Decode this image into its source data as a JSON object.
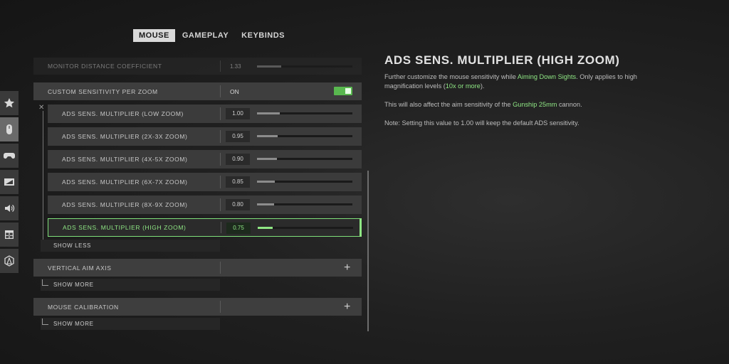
{
  "tabs": [
    "MOUSE",
    "GAMEPLAY",
    "KEYBINDS"
  ],
  "active_tab": "MOUSE",
  "sidebar_icons": [
    "star-icon",
    "mouse-icon",
    "gamepad-icon",
    "display-icon",
    "speaker-icon",
    "window-icon",
    "network-icon"
  ],
  "dim_row": {
    "label": "MONITOR DISTANCE COEFFICIENT",
    "value": "1.33",
    "level": 0.25
  },
  "custom_row": {
    "label": "CUSTOM SENSITIVITY PER ZOOM",
    "value": "ON"
  },
  "zoom_rows": [
    {
      "label": "ADS SENS. MULTIPLIER (LOW ZOOM)",
      "value": "1.00",
      "level": 0.24
    },
    {
      "label": "ADS SENS. MULTIPLIER (2X-3X ZOOM)",
      "value": "0.95",
      "level": 0.22
    },
    {
      "label": "ADS SENS. MULTIPLIER (4X-5X ZOOM)",
      "value": "0.90",
      "level": 0.21
    },
    {
      "label": "ADS SENS. MULTIPLIER (6X-7X ZOOM)",
      "value": "0.85",
      "level": 0.19
    },
    {
      "label": "ADS SENS. MULTIPLIER (8X-9X ZOOM)",
      "value": "0.80",
      "level": 0.18
    },
    {
      "label": "ADS SENS. MULTIPLIER (HIGH ZOOM)",
      "value": "0.75",
      "level": 0.16
    }
  ],
  "show_less": "SHOW LESS",
  "vertical_aim": {
    "label": "VERTICAL AIM AXIS",
    "show_more": "SHOW MORE"
  },
  "mouse_calibration": {
    "label": "MOUSE CALIBRATION",
    "show_more": "SHOW MORE"
  },
  "detail": {
    "title": "ADS SENS. MULTIPLIER (HIGH ZOOM)",
    "p1_a": "Further customize the mouse sensitivity while ",
    "p1_hl1": "Aiming Down Sights",
    "p1_b": ". Only applies to high magnification levels (",
    "p1_hl2": "10x or more",
    "p1_c": ").",
    "p2_a": "This will also affect the aim sensitivity of the ",
    "p2_hl": "Gunship 25mm",
    "p2_b": " cannon.",
    "p3": "Note: Setting this value to 1.00 will keep the default ADS sensitivity."
  },
  "colors": {
    "accent": "#8fe784",
    "toggle_on": "#59b84f"
  }
}
